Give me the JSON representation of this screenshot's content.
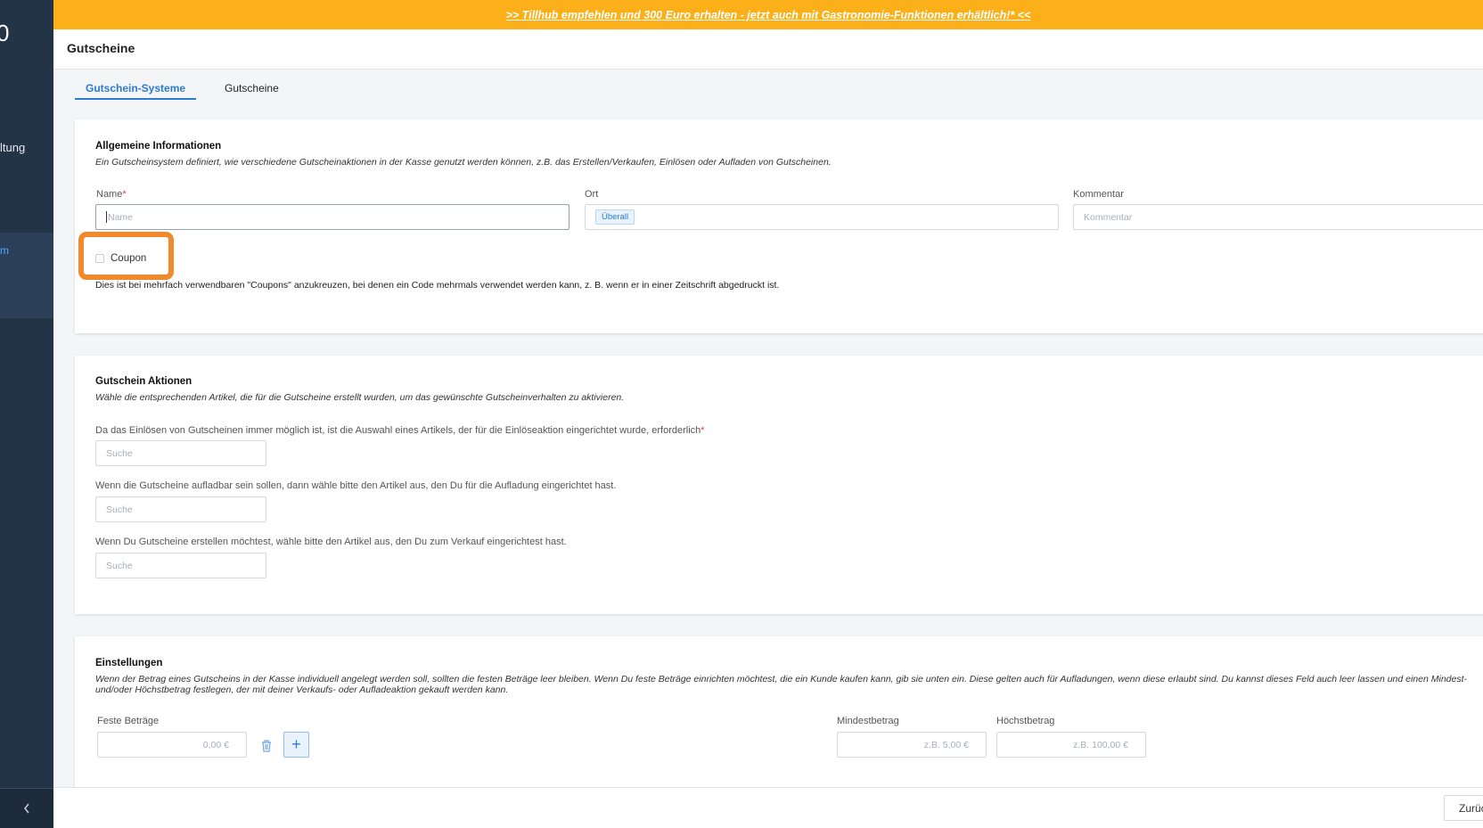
{
  "sidebar": {
    "logo_fragment": "0",
    "nav_fragment": "ltung",
    "active_fragment": "m",
    "collapse_icon": "chevron-left-icon"
  },
  "banner": {
    "text": ">> Tillhub empfehlen und 300 Euro erhalten - jetzt auch mit Gastronomie-Funktionen erhältlich!* <<",
    "color": "#fbb01a"
  },
  "header": {
    "title": "Gutscheine",
    "edge_fragment": "("
  },
  "tabs": [
    {
      "label": "Gutschein-Systeme",
      "active": true
    },
    {
      "label": "Gutscheine",
      "active": false
    }
  ],
  "general": {
    "title": "Allgemeine Informationen",
    "description": "Ein Gutscheinsystem definiert, wie verschiedene Gutscheinaktionen in der Kasse genutzt werden können, z.B. das Erstellen/Verkaufen, Einlösen oder Aufladen von Gutscheinen.",
    "name_label": "Name",
    "name_required": "*",
    "name_placeholder": "Name",
    "location_label": "Ort",
    "location_tag": "Überall",
    "comment_label": "Kommentar",
    "comment_placeholder": "Kommentar",
    "coupon_label": "Coupon",
    "coupon_checked": false,
    "coupon_hint": "Dies ist bei mehrfach verwendbaren \"Coupons\" anzukreuzen, bei denen ein Code mehrmals verwendet werden kann, z. B. wenn er in einer Zeitschrift abgedruckt ist."
  },
  "actions": {
    "title": "Gutschein Aktionen",
    "description": "Wähle die entsprechenden Artikel, die für die Gutscheine erstellt wurden, um das gewünschte Gutscheinverhalten zu aktivieren.",
    "redeem_label": "Da das Einlösen von Gutscheinen immer möglich ist, ist die Auswahl eines Artikels, der für die Einlöseaktion eingerichtet wurde, erforderlich",
    "redeem_required": "*",
    "topup_label": "Wenn die Gutscheine aufladbar sein sollen, dann wähle bitte den Artikel aus, den Du für die Aufladung eingerichtet hast.",
    "create_label": "Wenn Du Gutscheine erstellen möchtest, wähle bitte den Artikel aus, den Du zum Verkauf eingerichtest hast.",
    "search_placeholder": "Suche"
  },
  "settings": {
    "title": "Einstellungen",
    "description": "Wenn der Betrag eines Gutscheins in der Kasse individuell angelegt werden soll, sollten die festen Beträge leer bleiben. Wenn Du feste Beträge einrichten möchtest, die ein Kunde kaufen kann, gib sie unten ein. Diese gelten auch für Aufladungen, wenn diese erlaubt sind. Du kannst dieses Feld auch leer lassen und einen Mindest- und/oder Höchstbetrag festlegen, der mit deiner Verkaufs- oder Aufladeaktion gekauft werden kann.",
    "fixed_label": "Feste Beträge",
    "fixed_placeholder": "0,00 €",
    "min_label": "Mindestbetrag",
    "min_placeholder": "z.B. 5,00 €",
    "max_label": "Höchstbetrag",
    "max_placeholder": "z.B. 100,00 €",
    "add_symbol": "+"
  },
  "footer": {
    "back_label": "Zurück"
  },
  "colors": {
    "accent": "#2b7bd3",
    "highlight": "#f08a2d",
    "sidebar": "#243447"
  }
}
